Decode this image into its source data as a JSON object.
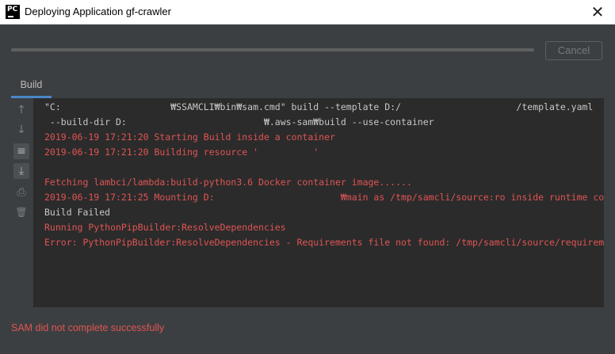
{
  "window": {
    "app_icon_text": "PC",
    "title": "Deploying Application gf-crawler",
    "close_glyph": "✕"
  },
  "progress": {
    "fraction": 1.0
  },
  "buttons": {
    "cancel_label": "Cancel"
  },
  "tabs": [
    {
      "label": "Build",
      "active": true
    }
  ],
  "toolbar": [
    {
      "icon": "arrow-up-icon",
      "glyph": "↑",
      "active": false
    },
    {
      "icon": "arrow-down-icon",
      "glyph": "↓",
      "active": false
    },
    {
      "icon": "soft-wrap-icon",
      "glyph": "≡",
      "active": true
    },
    {
      "icon": "scroll-to-end-icon",
      "glyph": "⤓",
      "active": true
    },
    {
      "icon": "print-icon",
      "glyph": "⎙",
      "active": false
    },
    {
      "icon": "trash-icon",
      "glyph": "🗑",
      "active": false
    }
  ],
  "console": {
    "lines": [
      {
        "text": "\"C:                    ₩SSAMCLI₩bin₩sam.cmd\" build --template D:/                     /template.yaml",
        "color": "white"
      },
      {
        "text": " --build-dir D:                         ₩.aws-sam₩build --use-container",
        "color": "white"
      },
      {
        "text": "2019-06-19 17:21:20 Starting Build inside a container",
        "color": "red"
      },
      {
        "text": "2019-06-19 17:21:20 Building resource '          '",
        "color": "red"
      },
      {
        "text": "",
        "color": "white"
      },
      {
        "text": "Fetching lambci/lambda:build-python3.6 Docker container image......",
        "color": "red"
      },
      {
        "text": "2019-06-19 17:21:25 Mounting D:                       ₩main as /tmp/samcli/source:ro inside runtime container",
        "color": "red"
      },
      {
        "text": "Build Failed",
        "color": "white"
      },
      {
        "text": "Running PythonPipBuilder:ResolveDependencies",
        "color": "red"
      },
      {
        "text": "Error: PythonPipBuilder:ResolveDependencies - Requirements file not found: /tmp/samcli/source/requirements.txt",
        "color": "red"
      }
    ]
  },
  "status_message": "SAM did not complete successfully",
  "colors": {
    "background": "#3c3f41",
    "console_bg": "#2b2b2b",
    "error_red": "#e05454",
    "tab_accent": "#4a88c7"
  }
}
